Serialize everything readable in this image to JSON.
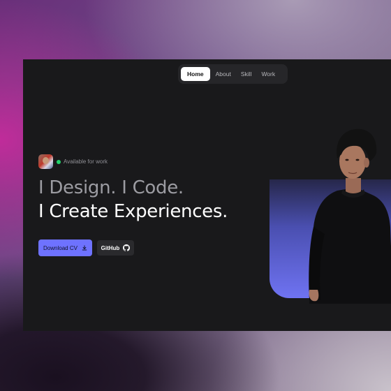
{
  "nav": {
    "items": [
      {
        "label": "Home",
        "active": true
      },
      {
        "label": "About",
        "active": false
      },
      {
        "label": "Skill",
        "active": false
      },
      {
        "label": "Work",
        "active": false
      }
    ]
  },
  "hero": {
    "status_text": "Available for work",
    "headline_line1": "I Design. I Code.",
    "headline_line2": "I Create Experiences.",
    "cta_primary": "Download CV",
    "cta_secondary": "GitHub"
  },
  "icons": {
    "primary_button": "download-icon",
    "secondary_button": "github-icon",
    "status": "status-dot"
  },
  "colors": {
    "accent": "#6e72ff",
    "status": "#22d36b",
    "background": "#19191b"
  }
}
